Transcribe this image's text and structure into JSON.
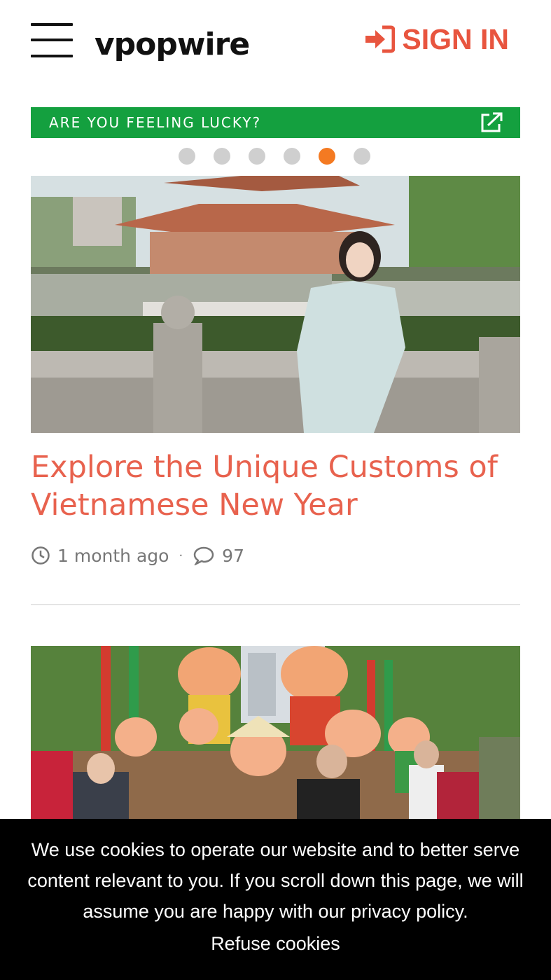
{
  "header": {
    "logo": "vpopwire",
    "signin_label": "SIGN IN",
    "accent_color": "#e8553f"
  },
  "banner": {
    "text": "ARE YOU FEELING LUCKY?",
    "color": "#14a03f",
    "icon": "external-link-icon"
  },
  "carousel": {
    "dot_count": 6,
    "active_index": 4
  },
  "articles": [
    {
      "title": "Explore the Unique Customs of Vietnamese New Year",
      "time": "1 month ago",
      "separator": "·",
      "comments": "97",
      "image": "woman-in-ao-dai-by-pagoda-lake"
    },
    {
      "image": "pig-mascot-tet-festival-crowd"
    }
  ],
  "cookie_bar": {
    "message": "We use cookies to operate our website and to better serve content relevant to you. If you scroll down this page, we will assume you are happy with our privacy policy.",
    "refuse_label": "Refuse cookies"
  }
}
